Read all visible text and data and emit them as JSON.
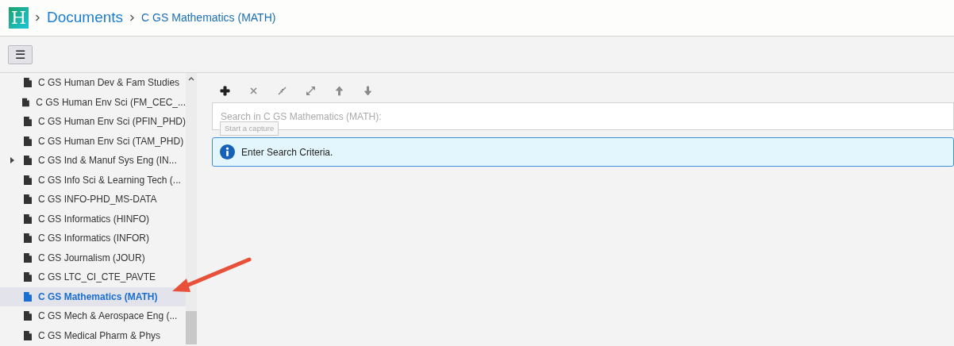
{
  "breadcrumb": [
    {
      "label": "Documents",
      "kind": "large"
    },
    {
      "label": "C GS Mathematics (MATH)",
      "kind": "small"
    }
  ],
  "logo": {
    "letter": "H"
  },
  "menu_button": {
    "label": "☰"
  },
  "tree": [
    {
      "label": "C GS Human Dev & Fam Studies",
      "selected": false,
      "expandable": false
    },
    {
      "label": "C GS Human Env Sci (FM_CEC_...",
      "selected": false,
      "expandable": false
    },
    {
      "label": "C GS Human Env Sci (PFIN_PHD)",
      "selected": false,
      "expandable": false
    },
    {
      "label": "C GS Human Env Sci (TAM_PHD)",
      "selected": false,
      "expandable": false
    },
    {
      "label": "C GS Ind & Manuf Sys Eng (IN...",
      "selected": false,
      "expandable": true
    },
    {
      "label": "C GS Info Sci & Learning Tech (...",
      "selected": false,
      "expandable": false
    },
    {
      "label": "C GS INFO-PHD_MS-DATA",
      "selected": false,
      "expandable": false
    },
    {
      "label": "C GS Informatics (HINFO)",
      "selected": false,
      "expandable": false
    },
    {
      "label": "C GS Informatics (INFOR)",
      "selected": false,
      "expandable": false
    },
    {
      "label": "C GS Journalism (JOUR)",
      "selected": false,
      "expandable": false
    },
    {
      "label": "C GS LTC_CI_CTE_PAVTE",
      "selected": false,
      "expandable": false
    },
    {
      "label": "C GS Mathematics (MATH)",
      "selected": true,
      "expandable": false
    },
    {
      "label": "C GS Mech & Aerospace Eng (...",
      "selected": false,
      "expandable": false
    },
    {
      "label": "C GS Medical Pharm & Phys",
      "selected": false,
      "expandable": false
    }
  ],
  "toolbar": [
    {
      "kind": "add",
      "disabled": false
    },
    {
      "kind": "remove",
      "disabled": true
    },
    {
      "kind": "collapse",
      "disabled": true
    },
    {
      "kind": "expand",
      "disabled": true
    },
    {
      "kind": "up",
      "disabled": true
    },
    {
      "kind": "down",
      "disabled": true
    }
  ],
  "search": {
    "placeholder": "Search in C GS Mathematics (MATH):"
  },
  "tooltip": {
    "text": "Start a capture"
  },
  "alert": {
    "text": "Enter Search Criteria."
  }
}
